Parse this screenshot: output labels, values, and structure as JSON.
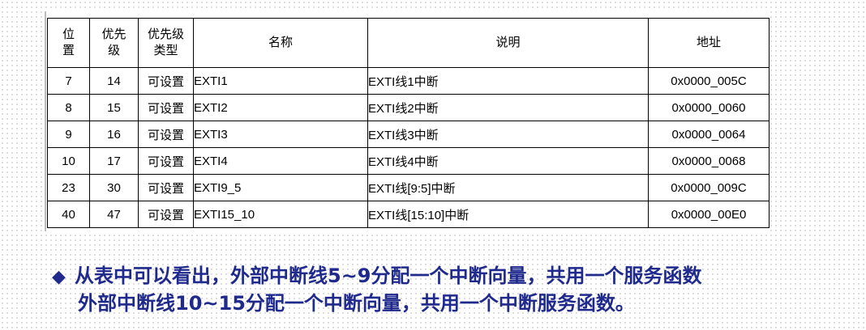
{
  "table": {
    "headers": {
      "position": [
        "位",
        "置"
      ],
      "priority": [
        "优先",
        "级"
      ],
      "priority_type": [
        "优先级",
        "类型"
      ],
      "name": "名称",
      "description": "说明",
      "address": "地址"
    },
    "rows": [
      {
        "position": "7",
        "priority": "14",
        "type": "可设置",
        "name": "EXTI1",
        "description": "EXTI线1中断",
        "address": "0x0000_005C"
      },
      {
        "position": "8",
        "priority": "15",
        "type": "可设置",
        "name": "EXTI2",
        "description": "EXTI线2中断",
        "address": "0x0000_0060"
      },
      {
        "position": "9",
        "priority": "16",
        "type": "可设置",
        "name": "EXTI3",
        "description": "EXTI线3中断",
        "address": "0x0000_0064"
      },
      {
        "position": "10",
        "priority": "17",
        "type": "可设置",
        "name": "EXTI4",
        "description": "EXTI线4中断",
        "address": "0x0000_0068"
      },
      {
        "position": "23",
        "priority": "30",
        "type": "可设置",
        "name": "EXTI9_5",
        "description": "EXTI线[9:5]中断",
        "address": "0x0000_009C"
      },
      {
        "position": "40",
        "priority": "47",
        "type": "可设置",
        "name": "EXTI15_10",
        "description": "EXTI线[15:10]中断",
        "address": "0x0000_00E0"
      }
    ]
  },
  "note": {
    "bullet_icon": "diamond-bullet-icon",
    "bullet_glyph": "◆",
    "line1": "从表中可以看出，外部中断线5~9分配一个中断向量，共用一个服务函数",
    "line2": "外部中断线10~15分配一个中断向量，共用一个中断服务函数。"
  },
  "colors": {
    "note_text": "#1f2a8c",
    "table_border": "#000000",
    "dot_pattern": "#d5d5d5"
  }
}
